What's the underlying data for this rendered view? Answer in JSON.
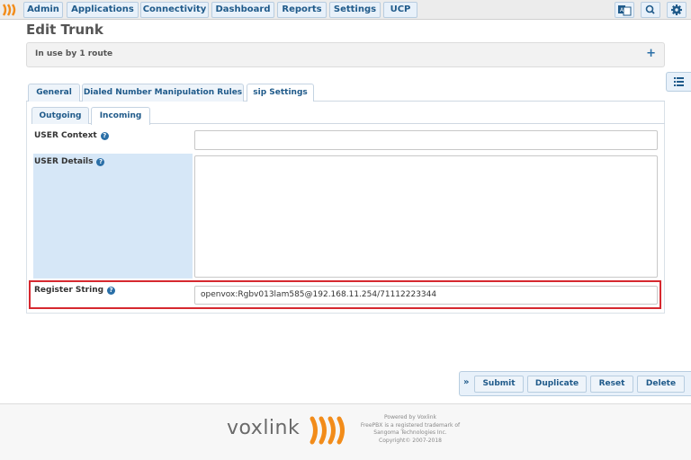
{
  "nav": {
    "items": [
      "Admin",
      "Applications",
      "Connectivity",
      "Dashboard",
      "Reports",
      "Settings",
      "UCP"
    ],
    "right_icons": [
      "translate-icon",
      "search-icon",
      "gear-icon"
    ]
  },
  "page": {
    "title": "Edit Trunk",
    "route_panel": {
      "label": "In use by 1 route",
      "expand": "+"
    }
  },
  "tabs": [
    "General",
    "Dialed Number Manipulation Rules",
    "sip Settings"
  ],
  "active_tab": "sip Settings",
  "subtabs": [
    "Outgoing",
    "Incoming"
  ],
  "active_subtab": "Incoming",
  "form": {
    "user_context": {
      "label": "USER Context",
      "help": "?",
      "value": ""
    },
    "user_details": {
      "label": "USER Details",
      "help": "?",
      "value": ""
    },
    "register_string": {
      "label": "Register String",
      "help": "?",
      "value": "openvox:Rgbv013lam585@192.168.11.254/71112223344"
    }
  },
  "actions": {
    "toggle": "»",
    "submit": "Submit",
    "duplicate": "Duplicate",
    "reset": "Reset",
    "delete": "Delete"
  },
  "footer": {
    "brand": "voxlink",
    "lines": [
      "Powered by Voxlink",
      "FreePBX is a registered trademark of",
      "Sangoma Technologies Inc.",
      "Copyright© 2007-2018"
    ]
  },
  "colors": {
    "accent": "#1f5a8a",
    "label_bg": "#d6e7f7",
    "highlight": "#d6282f",
    "logo_orange": "#f28c1a"
  }
}
